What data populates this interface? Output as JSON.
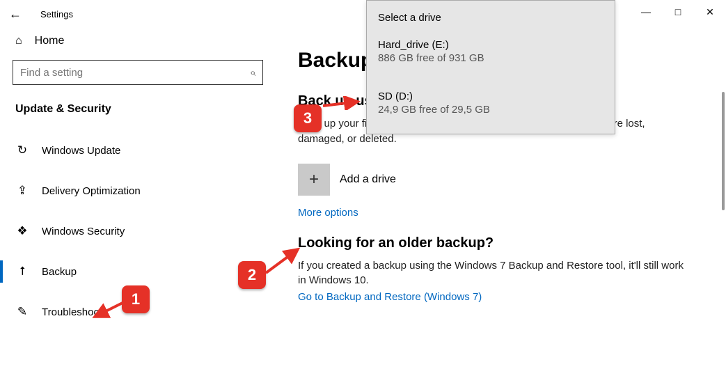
{
  "window": {
    "title": "Settings",
    "minimize": "—",
    "maximize": "□",
    "close": "✕"
  },
  "nav": {
    "home": "Home",
    "search_placeholder": "Find a setting",
    "section": "Update & Security",
    "items": [
      {
        "icon": "↻",
        "label": "Windows Update"
      },
      {
        "icon": "⇪",
        "label": "Delivery Optimization"
      },
      {
        "icon": "❖",
        "label": "Windows Security"
      },
      {
        "icon": "⭡",
        "label": "Backup"
      },
      {
        "icon": "✎",
        "label": "Troubleshoot"
      }
    ]
  },
  "main": {
    "page_title": "Backup",
    "section1_title": "Back up using File History",
    "section1_body": "Back up your files to another drive and restore them if the originals are lost, damaged, or deleted.",
    "add_drive_label": "Add a drive",
    "add_drive_plus": "+",
    "more_options": "More options",
    "section2_title": "Looking for an older backup?",
    "section2_body": "If you created a backup using the Windows 7 Backup and Restore tool, it'll still work in Windows 10.",
    "section2_link": "Go to Backup and Restore (Windows 7)"
  },
  "flyout": {
    "title": "Select a drive",
    "drives": [
      {
        "name": "Hard_drive (E:)",
        "free": "886 GB free of 931 GB"
      },
      {
        "name": "SD (D:)",
        "free": "24,9 GB free of 29,5 GB"
      }
    ]
  },
  "annotations": {
    "b1": "1",
    "b2": "2",
    "b3": "3"
  }
}
